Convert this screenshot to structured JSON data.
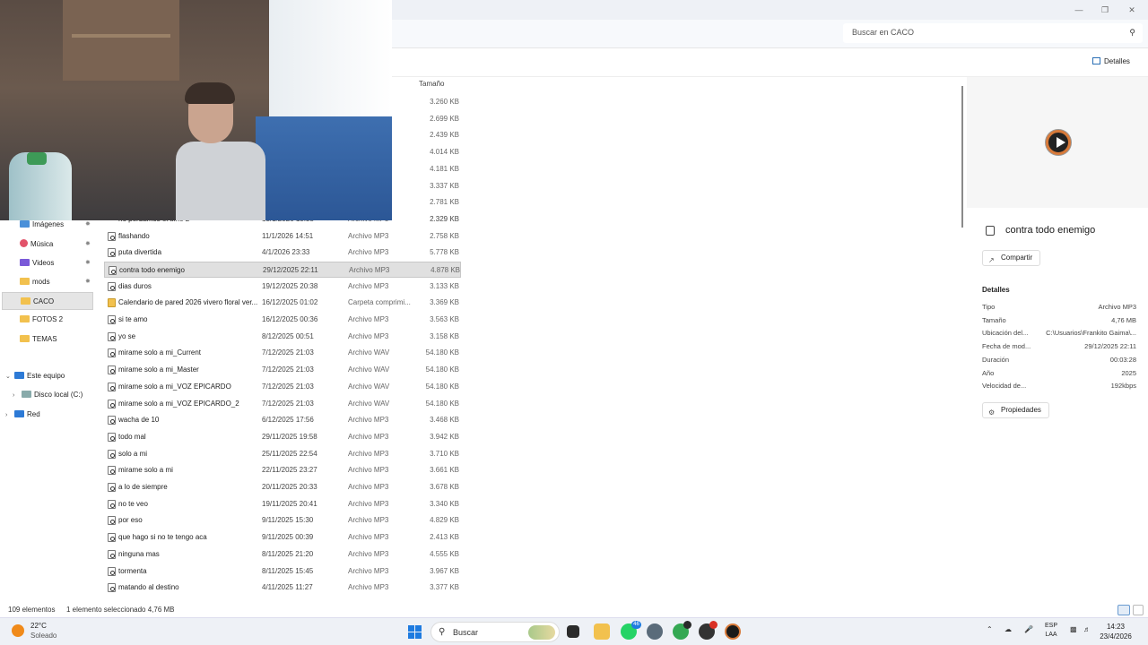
{
  "window": {
    "minimize": "—",
    "maximize": "❐",
    "close": "✕"
  },
  "search": {
    "placeholder": "Buscar en CACO",
    "icon": "search-icon"
  },
  "toolbar": {
    "details_label": "Detalles"
  },
  "columns": {
    "size": "Tamaño"
  },
  "sizes_top": [
    "3.260 KB",
    "2.699 KB",
    "2.439 KB",
    "4.014 KB",
    "4.181 KB",
    "3.337 KB",
    "2.781 KB",
    "2.329 KB"
  ],
  "partial_row": {
    "name": "no perdamos el time 2",
    "date": "13/1/2026 15:38",
    "type": "Archivo MP3"
  },
  "nav": {
    "items": [
      {
        "label": "Imágenes",
        "icon": "pictures-icon",
        "pinned": true
      },
      {
        "label": "Música",
        "icon": "music-icon",
        "pinned": true
      },
      {
        "label": "Videos",
        "icon": "videos-icon",
        "pinned": true
      },
      {
        "label": "mods",
        "icon": "folder-icon",
        "pinned": true
      },
      {
        "label": "CACO",
        "icon": "folder-icon",
        "pinned": false
      },
      {
        "label": "FOTOS 2",
        "icon": "folder-icon",
        "pinned": false
      },
      {
        "label": "TEMAS",
        "icon": "folder-icon",
        "pinned": false
      }
    ],
    "this_pc": "Este equipo",
    "local_disk": "Disco local (C:)",
    "network": "Red"
  },
  "files": [
    {
      "name": "flashando",
      "date": "11/1/2026 14:51",
      "type": "Archivo MP3",
      "size": "2.758 KB"
    },
    {
      "name": "puta divertida",
      "date": "4/1/2026 23:33",
      "type": "Archivo MP3",
      "size": "5.778 KB"
    },
    {
      "name": "contra todo enemigo",
      "date": "29/12/2025 22:11",
      "type": "Archivo MP3",
      "size": "4.878 KB",
      "selected": true
    },
    {
      "name": "dias duros",
      "date": "19/12/2025 20:38",
      "type": "Archivo MP3",
      "size": "3.133 KB"
    },
    {
      "name": "Calendario de pared 2026 vivero floral ver...",
      "date": "16/12/2025 01:02",
      "type": "Carpeta comprimi...",
      "size": "3.369 KB",
      "zip": true
    },
    {
      "name": "si te amo",
      "date": "16/12/2025 00:36",
      "type": "Archivo MP3",
      "size": "3.563 KB"
    },
    {
      "name": "yo se",
      "date": "8/12/2025 00:51",
      "type": "Archivo MP3",
      "size": "3.158 KB"
    },
    {
      "name": "mirame solo a mi_Current",
      "date": "7/12/2025 21:03",
      "type": "Archivo WAV",
      "size": "54.180 KB"
    },
    {
      "name": "mirame solo a mi_Master",
      "date": "7/12/2025 21:03",
      "type": "Archivo WAV",
      "size": "54.180 KB"
    },
    {
      "name": "mirame solo a mi_VOZ EPICARDO",
      "date": "7/12/2025 21:03",
      "type": "Archivo WAV",
      "size": "54.180 KB"
    },
    {
      "name": "mirame solo a mi_VOZ EPICARDO_2",
      "date": "7/12/2025 21:03",
      "type": "Archivo WAV",
      "size": "54.180 KB"
    },
    {
      "name": "wacha de 10",
      "date": "6/12/2025 17:56",
      "type": "Archivo MP3",
      "size": "3.468 KB"
    },
    {
      "name": "todo mal",
      "date": "29/11/2025 19:58",
      "type": "Archivo MP3",
      "size": "3.942 KB"
    },
    {
      "name": "solo a mi",
      "date": "25/11/2025 22:54",
      "type": "Archivo MP3",
      "size": "3.710 KB"
    },
    {
      "name": "mirame solo a mi",
      "date": "22/11/2025 23:27",
      "type": "Archivo MP3",
      "size": "3.661 KB"
    },
    {
      "name": "a lo de siempre",
      "date": "20/11/2025 20:33",
      "type": "Archivo MP3",
      "size": "3.678 KB"
    },
    {
      "name": "no te veo",
      "date": "19/11/2025 20:41",
      "type": "Archivo MP3",
      "size": "3.340 KB"
    },
    {
      "name": "por eso",
      "date": "9/11/2025 15:30",
      "type": "Archivo MP3",
      "size": "4.829 KB"
    },
    {
      "name": "que hago si no te tengo aca",
      "date": "9/11/2025 00:39",
      "type": "Archivo MP3",
      "size": "2.413 KB"
    },
    {
      "name": "ninguna mas",
      "date": "8/11/2025 21:20",
      "type": "Archivo MP3",
      "size": "4.555 KB"
    },
    {
      "name": "tormenta",
      "date": "8/11/2025 15:45",
      "type": "Archivo MP3",
      "size": "3.967 KB"
    },
    {
      "name": "matando al destino",
      "date": "4/11/2025 11:27",
      "type": "Archivo MP3",
      "size": "3.377 KB"
    }
  ],
  "details": {
    "name": "contra todo enemigo",
    "share": "Compartir",
    "heading": "Detalles",
    "props": [
      {
        "k": "Tipo",
        "v": "Archivo MP3"
      },
      {
        "k": "Tamaño",
        "v": "4,76 MB"
      },
      {
        "k": "Ubicación del...",
        "v": "C:\\Usuarios\\Frankito Gaima\\..."
      },
      {
        "k": "Fecha de mod...",
        "v": "29/12/2025 22:11"
      },
      {
        "k": "Duración",
        "v": "00:03:28"
      },
      {
        "k": "Año",
        "v": "2025"
      },
      {
        "k": "Velocidad de...",
        "v": "192kbps"
      }
    ],
    "properties_btn": "Propiedades"
  },
  "status": {
    "count": "109 elementos",
    "selected": "1 elemento seleccionado  4,76 MB"
  },
  "taskbar": {
    "temp": "22°C",
    "weather": "Soleado",
    "search": "Buscar",
    "whatsapp_badge": "46",
    "lang1": "ESP",
    "lang2": "LAA",
    "time": "14:23",
    "date": "23/4/2026"
  },
  "colors": {
    "accent": "#1e7be0",
    "selection": "#e0e0e0"
  }
}
